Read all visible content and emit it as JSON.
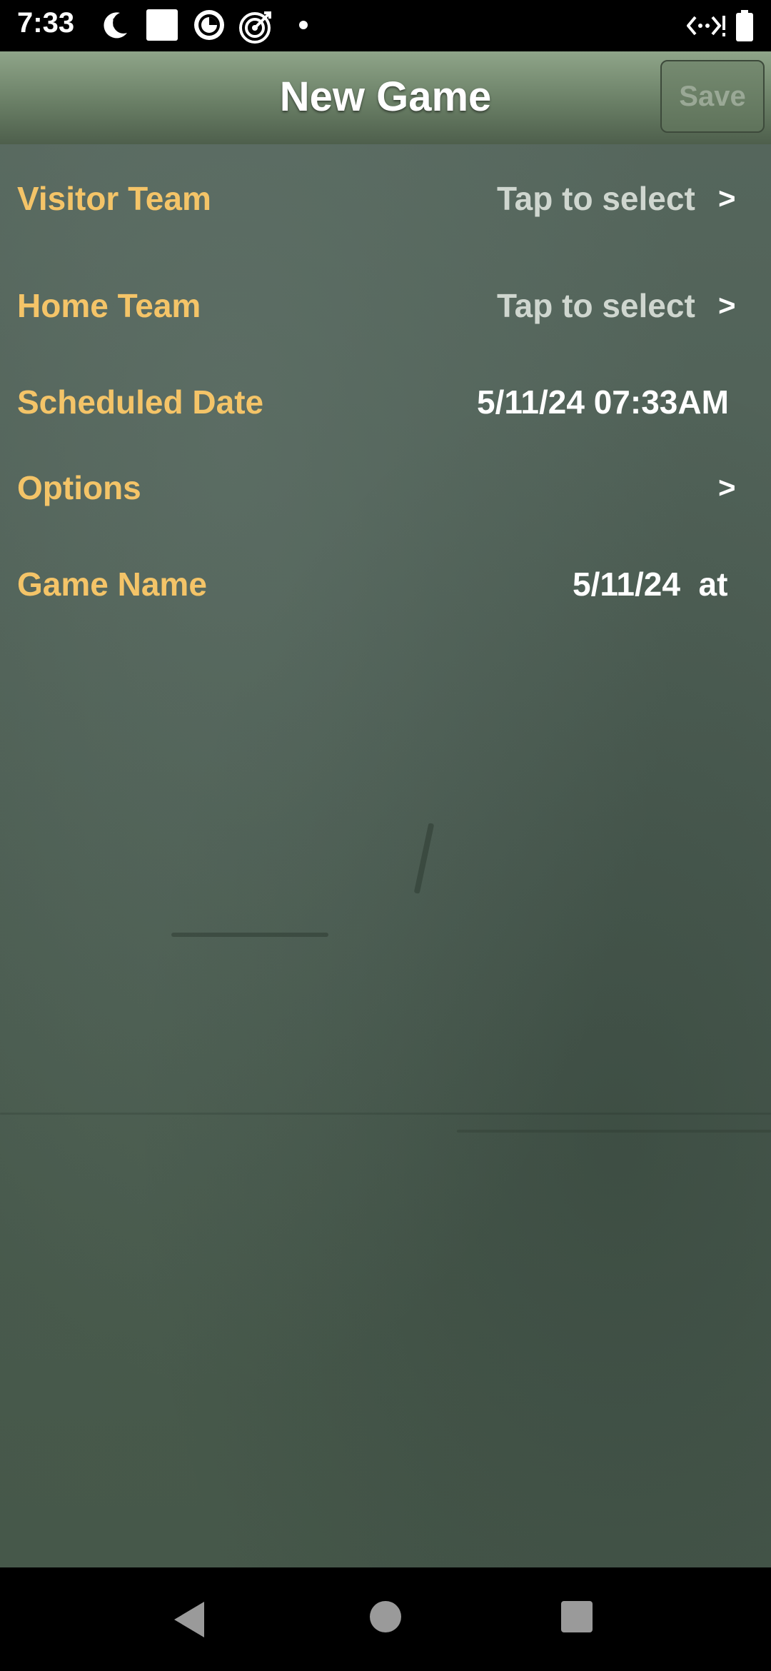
{
  "status_bar": {
    "time": "7:33",
    "left_icons": [
      "clock-moon-icon",
      "square-icon",
      "circle-badge-icon",
      "target-icon",
      "dot-icon"
    ],
    "right_icons": [
      "data-signal-icon",
      "battery-icon"
    ]
  },
  "app_bar": {
    "title": "New Game",
    "save_label": "Save"
  },
  "form": {
    "visitor_team": {
      "label": "Visitor Team",
      "value": "Tap to select",
      "chevron": ">"
    },
    "home_team": {
      "label": "Home Team",
      "value": "Tap to select",
      "chevron": ">"
    },
    "scheduled_date": {
      "label": "Scheduled Date",
      "value": "5/11/24 07:33AM"
    },
    "options": {
      "label": "Options",
      "chevron": ">"
    },
    "game_name": {
      "label": "Game Name",
      "value": "5/11/24  at"
    }
  },
  "nav_bar": {
    "icons": [
      "back-icon",
      "home-icon",
      "recents-icon"
    ]
  },
  "colors": {
    "label": "#f4c468",
    "value_muted": "#cfd6cf",
    "value_bright": "#ffffff",
    "app_bar": "#6a7f66",
    "background": "#4c5d53"
  }
}
